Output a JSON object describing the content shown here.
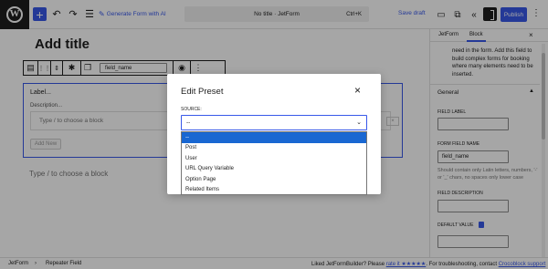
{
  "toolbar": {
    "wp_logo": "W",
    "generate_label": "Generate Form with AI",
    "document_title": "No title · JetForm",
    "shortcut": "Ctrl+K",
    "save_draft": "Save draft",
    "publish": "Publish",
    "icons": [
      "plus-icon",
      "undo-icon",
      "redo-icon",
      "list-view-icon",
      "magic-wand-icon",
      "desktop-preview-icon",
      "external-view-icon",
      "collapse-icon",
      "settings-icon",
      "more-options-icon"
    ]
  },
  "editor": {
    "title_placeholder": "Add title",
    "field_name": "field_name",
    "repeater": {
      "label": "Label...",
      "description": "Description...",
      "inner_placeholder": "Type / to choose a block",
      "remove": "×",
      "add_new": "Add New"
    },
    "append_placeholder": "Type / to choose a block"
  },
  "sidebar": {
    "tabs": [
      "JetForm",
      "Block"
    ],
    "active_tab": "Block",
    "close": "×",
    "block_description": "need in the form. Add this field to build complex forms for booking where many elements need to be inserted.",
    "section_title": "General",
    "field_label_label": "FIELD LABEL",
    "field_label_value": "",
    "form_field_name_label": "FORM FIELD NAME",
    "form_field_name_value": "field_name",
    "form_field_name_help": "Should contain only Latin letters, numbers, '-' or '_' chars, no spaces only lower case",
    "field_description_label": "FIELD DESCRIPTION",
    "field_description_value": "",
    "default_value_label": "DEFAULT VALUE",
    "default_value_value": ""
  },
  "statusbar": {
    "breadcrumbs": [
      "JetForm",
      "Repeater Field"
    ],
    "separator": "›",
    "message_prefix": "Liked JetFormBuilder? Please",
    "rate_link": "rate it ★★★★★",
    "message_middle": ". For troubleshooting, contact",
    "support_link": "Crocoblock support"
  },
  "modal": {
    "title": "Edit Preset",
    "close": "×",
    "source_label": "SOURCE:",
    "source_value": "--",
    "options": [
      "--",
      "Post",
      "User",
      "URL Query Variable",
      "Option Page",
      "Related Items"
    ],
    "selected_option": "--"
  },
  "colors": {
    "accent": "#3858e9",
    "dropdown_selected": "#1967d2",
    "overlay": "rgba(0,0,0,0.35)"
  }
}
